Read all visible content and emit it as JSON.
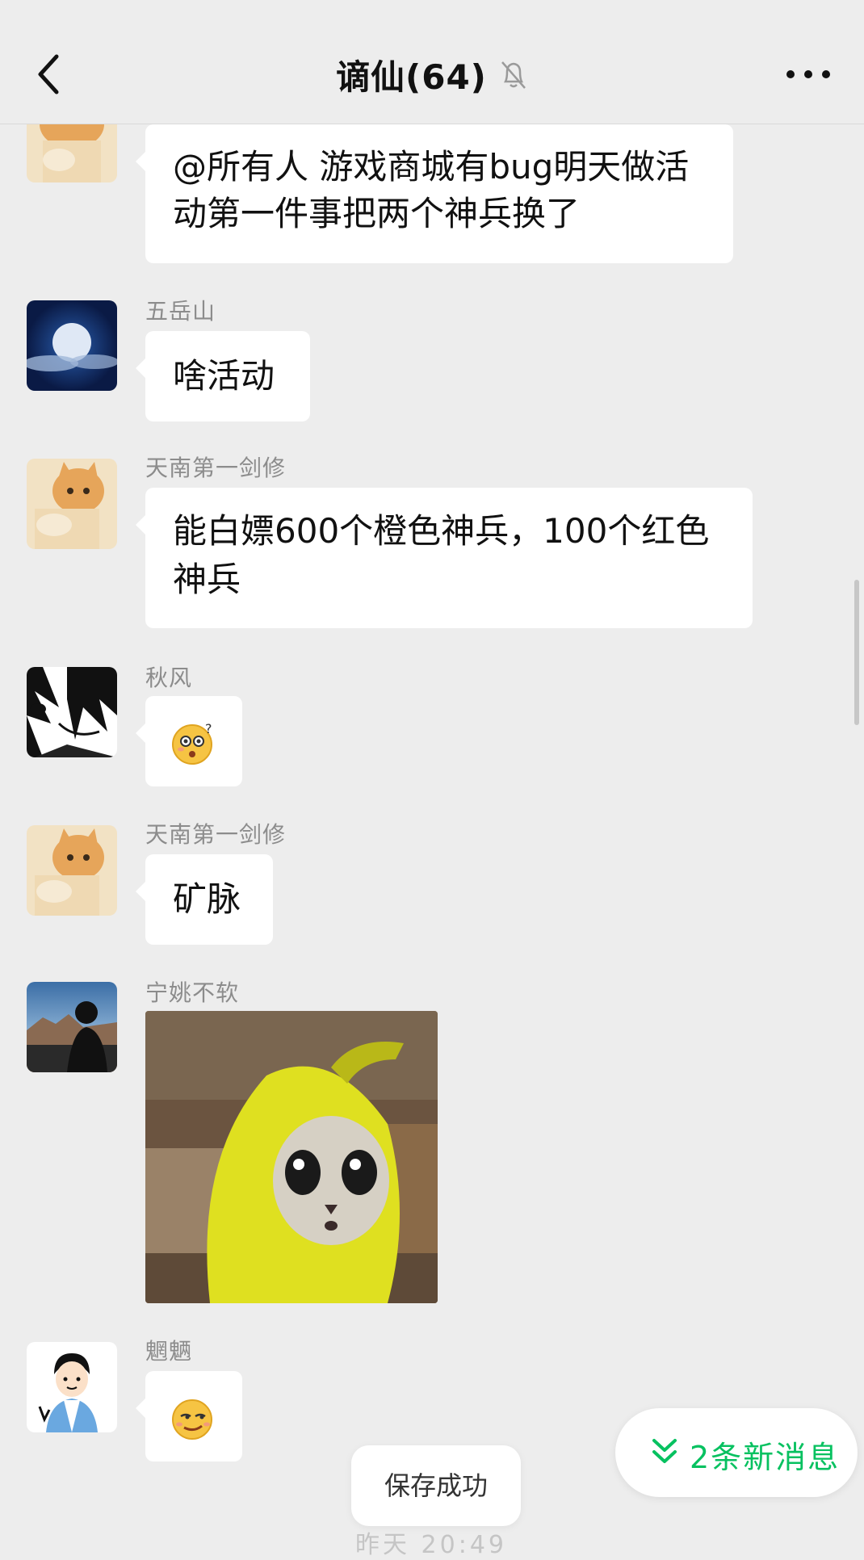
{
  "header": {
    "title": "谪仙(64)",
    "back_icon": "chevron-left-icon",
    "mute_icon": "bell-off-icon",
    "more_icon": "more-dots-icon"
  },
  "messages": [
    {
      "sender": "",
      "avatar": "cat-avatar",
      "text": "@所有人 游戏商城有bug明天做活动第一件事把两个神兵换了"
    },
    {
      "sender": "五岳山",
      "avatar": "moon-avatar",
      "text": "啥活动"
    },
    {
      "sender": "天南第一剑修",
      "avatar": "cat-avatar",
      "text": "能白嫖600个橙色神兵，100个红色神兵"
    },
    {
      "sender": "秋风",
      "avatar": "anime-avatar",
      "emoji": "confused-emoji"
    },
    {
      "sender": "天南第一剑修",
      "avatar": "cat-avatar",
      "text": "矿脉"
    },
    {
      "sender": "宁姚不软",
      "avatar": "silhouette-avatar",
      "image": "banana-cat-sticker"
    },
    {
      "sender": "魍魉",
      "avatar": "cartoon-boy-avatar",
      "emoji": "smirk-emoji"
    }
  ],
  "new_messages": {
    "label": "2条新消息",
    "color": "#07c160"
  },
  "toast": {
    "label": "保存成功"
  },
  "footer_time": "昨天 20:49"
}
